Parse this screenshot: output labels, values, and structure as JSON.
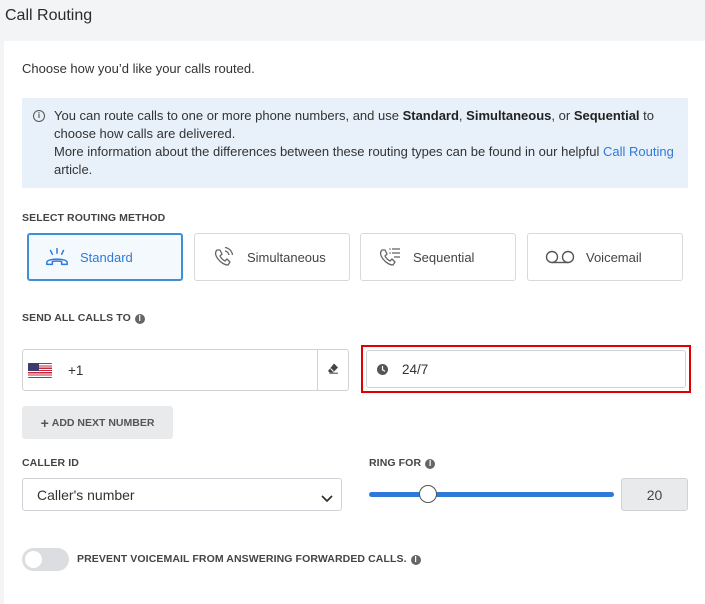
{
  "page": {
    "title": "Call Routing",
    "intro": "Choose how you’d like your calls routed."
  },
  "info": {
    "part1": "You can route calls to one or more phone numbers, and use ",
    "standard": "Standard",
    "comma1": ", ",
    "simultaneous": "Simultaneous",
    "or": ", or ",
    "sequential": "Sequential",
    "part2": " to choose how calls are delivered.",
    "part3": "More information about the differences between these routing types can be found in our helpful ",
    "link": "Call Routing",
    "part4": " article."
  },
  "routing": {
    "label": "SELECT ROUTING METHOD",
    "selected": "Standard",
    "methods": [
      {
        "label": "Standard",
        "icon": "standard-phone-icon"
      },
      {
        "label": "Simultaneous",
        "icon": "simultaneous-phone-icon"
      },
      {
        "label": "Sequential",
        "icon": "sequential-phone-icon"
      },
      {
        "label": "Voicemail",
        "icon": "voicemail-icon"
      }
    ]
  },
  "send_calls": {
    "label": "SEND ALL CALLS TO",
    "country_code": "+1",
    "flag": "us-flag-icon",
    "schedule": "24/7",
    "add_button": "ADD NEXT NUMBER"
  },
  "caller_id": {
    "label": "CALLER ID",
    "value": "Caller's number"
  },
  "ring_for": {
    "label": "RING FOR",
    "value": "20",
    "slider_fraction": 0.24
  },
  "voicemail_toggle": {
    "label": "PREVENT VOICEMAIL FROM ANSWERING FORWARDED CALLS.",
    "enabled": false
  },
  "colors": {
    "accent": "#2f7ad9",
    "highlight": "#e00000",
    "info_bg": "#e8f0fa"
  }
}
